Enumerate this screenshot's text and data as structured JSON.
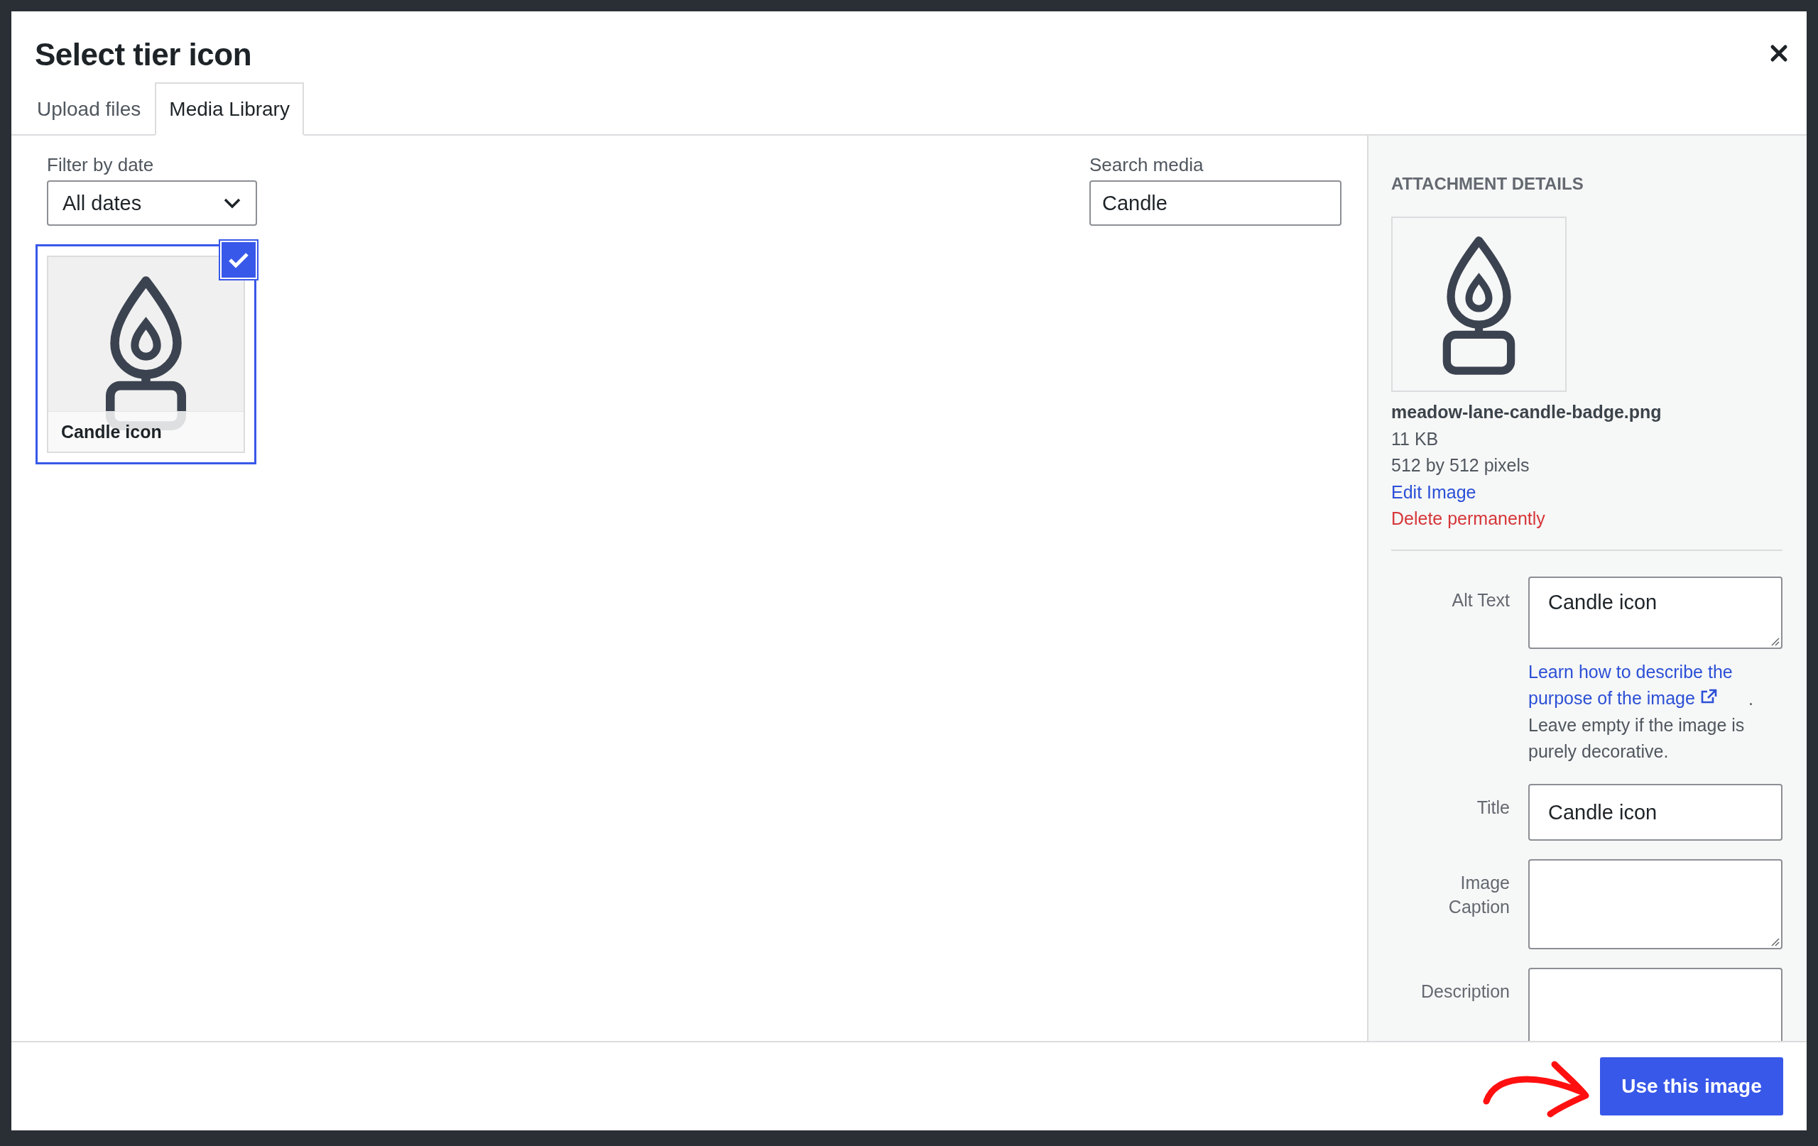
{
  "dialog": {
    "title": "Select tier icon"
  },
  "tabs": [
    {
      "label": "Upload files",
      "selected": false
    },
    {
      "label": "Media Library",
      "selected": true
    }
  ],
  "filter": {
    "label": "Filter by date",
    "value": "All dates"
  },
  "search": {
    "label": "Search media",
    "value": "Candle"
  },
  "media_items": [
    {
      "caption": "Candle icon",
      "selected": true,
      "checked": true
    }
  ],
  "details": {
    "heading": "ATTACHMENT DETAILS",
    "filename": "meadow-lane-candle-badge.png",
    "size": "11 KB",
    "dimensions": "512 by 512 pixels",
    "edit_link": "Edit Image",
    "delete_link": "Delete permanently",
    "fields": [
      {
        "label": "Alt Text",
        "value": "Candle icon",
        "kind": "textarea",
        "help_link": "Learn how to describe the purpose of the image",
        "help_link_end": ".",
        "help_text": "Leave empty if the image is purely decorative."
      },
      {
        "label": "Title",
        "value": "Candle icon",
        "kind": "input"
      },
      {
        "label": "Image Caption",
        "kind": "textarea"
      },
      {
        "label": "Description",
        "kind": "textarea"
      }
    ]
  },
  "footer": {
    "button": "Use this image"
  }
}
